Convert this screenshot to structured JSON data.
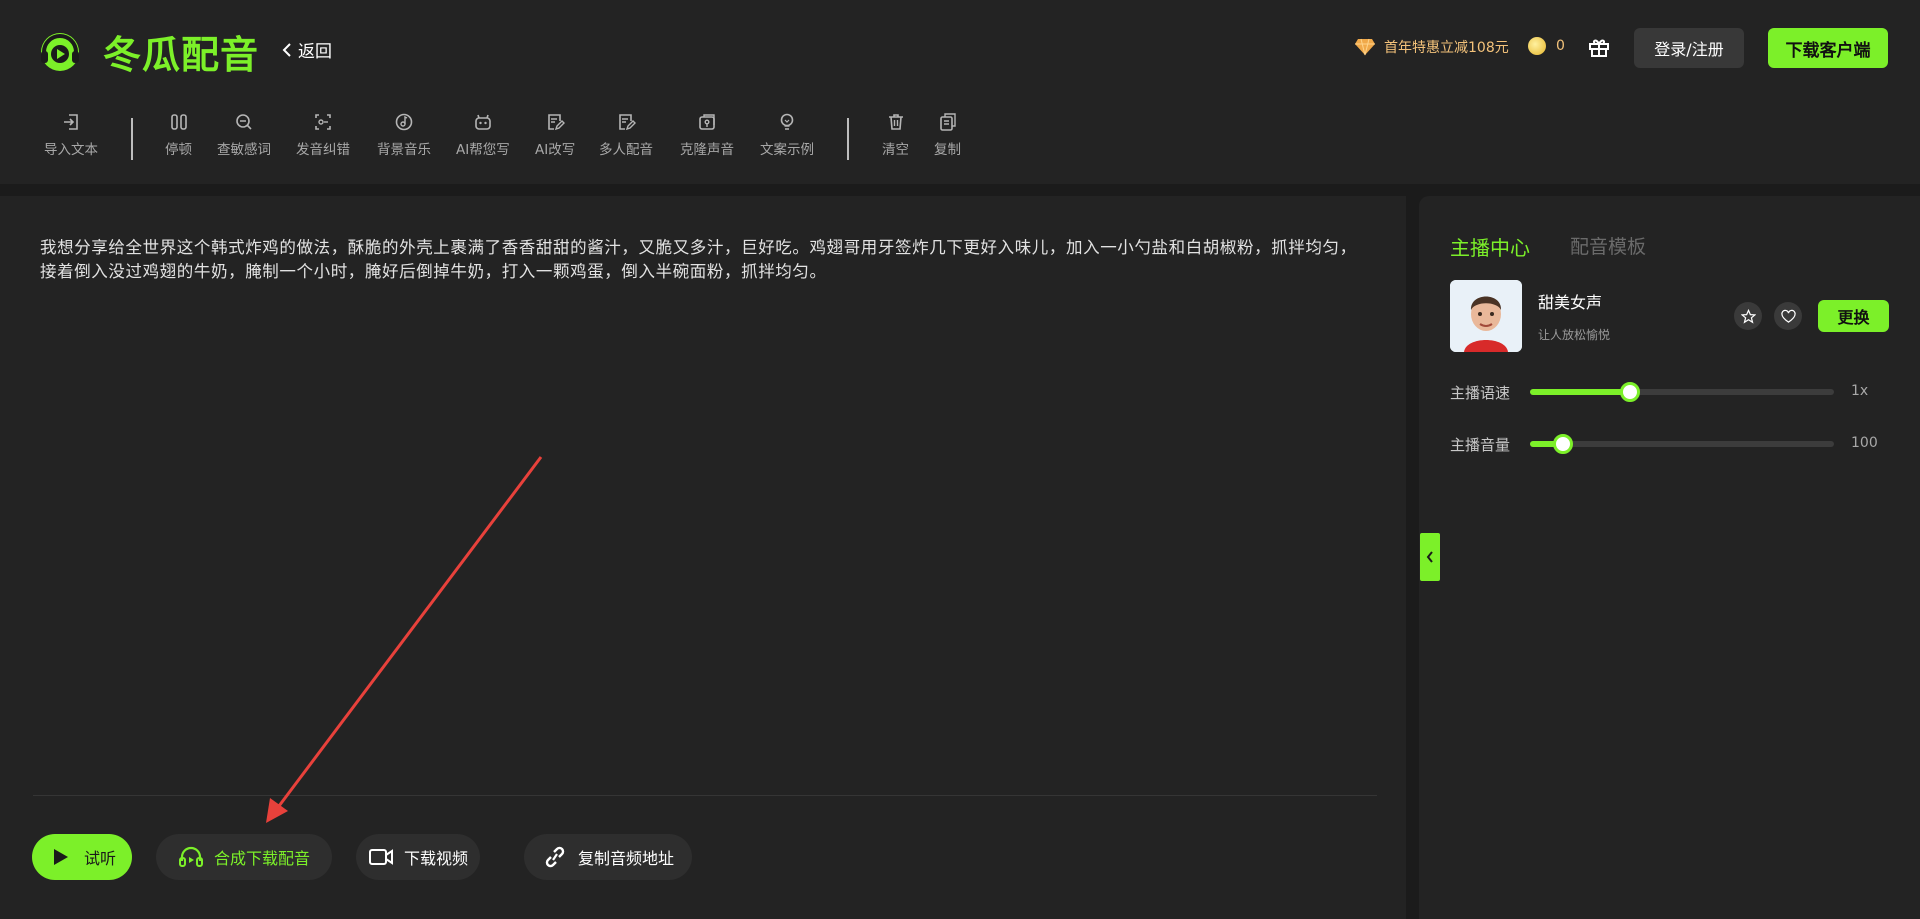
{
  "header": {
    "brand": "冬瓜配音",
    "back_label": "返回",
    "promo_text": "首年特惠立减108元",
    "coin_count": "0",
    "login_label": "登录/注册",
    "download_client_label": "下载客户端"
  },
  "toolbar": {
    "items": [
      {
        "label": "导入文本",
        "icon": "import-icon"
      },
      {
        "label": "停顿",
        "icon": "pause-icon"
      },
      {
        "label": "查敏感词",
        "icon": "search-icon"
      },
      {
        "label": "发音纠错",
        "icon": "pronunciation-icon"
      },
      {
        "label": "背景音乐",
        "icon": "music-icon"
      },
      {
        "label": "AI帮您写",
        "icon": "robot-icon"
      },
      {
        "label": "AI改写",
        "icon": "edit-doc-icon"
      },
      {
        "label": "多人配音",
        "icon": "multi-voice-icon"
      },
      {
        "label": "克隆声音",
        "icon": "clone-icon"
      },
      {
        "label": "文案示例",
        "icon": "bulb-icon"
      },
      {
        "label": "清空",
        "icon": "trash-icon"
      },
      {
        "label": "复制",
        "icon": "copy-icon"
      }
    ]
  },
  "editor": {
    "text": "我想分享给全世界这个韩式炸鸡的做法，酥脆的外壳上裹满了香香甜甜的酱汁，又脆又多汁，巨好吃。鸡翅哥用牙签炸几下更好入味儿，加入一小勺盐和白胡椒粉，抓拌均匀，接着倒入没过鸡翅的牛奶，腌制一个小时，腌好后倒掉牛奶，打入一颗鸡蛋，倒入半碗面粉，抓拌均匀。"
  },
  "actions": {
    "listen": "试听",
    "synthesize": "合成下载配音",
    "download_video": "下载视频",
    "copy_audio_url": "复制音频地址"
  },
  "panel": {
    "tab_active": "主播中心",
    "tab_other": "配音模板",
    "voice": {
      "name": "甜美女声",
      "desc": "让人放松愉悦"
    },
    "replace_label": "更换",
    "speed": {
      "label": "主播语速",
      "value": "1x",
      "fraction": 0.33
    },
    "volume": {
      "label": "主播音量",
      "value": "100",
      "fraction": 0.11
    }
  },
  "colors": {
    "accent": "#7cf029",
    "annotation_arrow": "#e8413b"
  }
}
